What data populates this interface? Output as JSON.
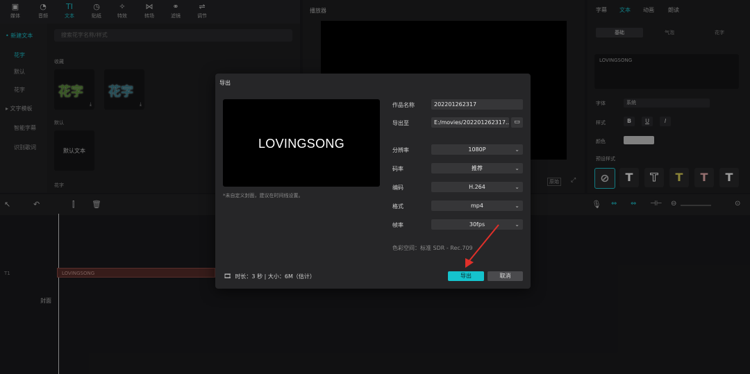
{
  "toolbar": {
    "tabs": [
      {
        "label": "媒体",
        "icon": "media-icon"
      },
      {
        "label": "音频",
        "icon": "audio-icon"
      },
      {
        "label": "文本",
        "icon": "text-icon"
      },
      {
        "label": "贴纸",
        "icon": "sticker-icon"
      },
      {
        "label": "特效",
        "icon": "effects-icon"
      },
      {
        "label": "转场",
        "icon": "transition-icon"
      },
      {
        "label": "滤镜",
        "icon": "filter-icon"
      },
      {
        "label": "调节",
        "icon": "adjust-icon"
      }
    ]
  },
  "sidebar": {
    "items": [
      "• 新建文本",
      "花字",
      "默认",
      "花字",
      "▸ 文字模板",
      "智能字幕",
      "识别歌词"
    ],
    "search_placeholder": "搜索花字名称/样式"
  },
  "library": {
    "section_favorites": "收藏",
    "section_default": "默认",
    "section_flower": "花字",
    "thumb_text": "花字",
    "default_text": "默认文本"
  },
  "player": {
    "title": "播放器",
    "ratio_label": "原始"
  },
  "inspector": {
    "tabs": [
      "字幕",
      "文本",
      "动画",
      "朗读"
    ],
    "subtabs": [
      "基础",
      "气泡",
      "花字"
    ],
    "text_value": "LOVINGSONG",
    "font_label": "字体",
    "font_value": "系统",
    "style_label": "样式",
    "color_label": "颜色",
    "preset_label": "预设样式"
  },
  "timeline": {
    "clip_label": "LOVINGSONG",
    "track_label": "T1",
    "cover_label": "封面"
  },
  "dialog": {
    "title": "导出",
    "preview_text": "LOVINGSONG",
    "hint": "*未自定义封面，建议在时间线设置。",
    "fields": {
      "name_label": "作品名称",
      "name_value": "202201262317",
      "path_label": "导出至",
      "path_value": "E:/movies/202201262317...",
      "resolution_label": "分辨率",
      "resolution_value": "1080P",
      "bitrate_label": "码率",
      "bitrate_value": "推荐",
      "codec_label": "编码",
      "codec_value": "H.264",
      "format_label": "格式",
      "format_value": "mp4",
      "fps_label": "帧率",
      "fps_value": "30fps"
    },
    "color_space": "色彩空间：标准 SDR - Rec.709",
    "footer_info": "时长：3 秒 | 大小：6M（估计）",
    "export_label": "导出",
    "cancel_label": "取消"
  },
  "colors": {
    "accent": "#15c3cd",
    "arrow": "#e0302a",
    "clip": "#5a2e2b"
  }
}
